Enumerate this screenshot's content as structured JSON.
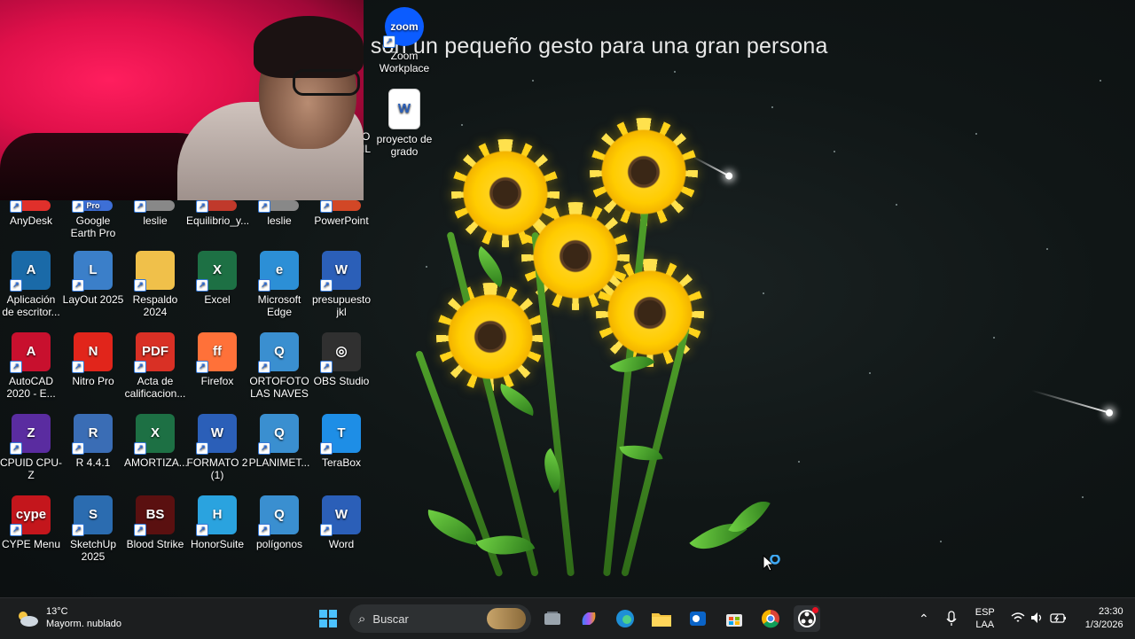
{
  "headline": "s son un pequeño gesto para una gran persona",
  "top_icons": [
    {
      "label": "Zoom Workplace",
      "badge": "zoom",
      "color": "#0b5cff"
    },
    {
      "label": "proyecto de grado",
      "badge": "W",
      "color": "#2b5fb8"
    }
  ],
  "partial_labels": [
    "O",
    "IL"
  ],
  "rows": [
    [
      {
        "label": "AnyDesk",
        "badge": "",
        "color": "#e0302b"
      },
      {
        "label": "Google Earth Pro",
        "badge": "Pro",
        "color": "#3d6fd6"
      },
      {
        "label": "leslie",
        "badge": "",
        "color": "#888"
      },
      {
        "label": "Equilibrio_y...",
        "badge": "",
        "color": "#c0392b"
      },
      {
        "label": "leslie",
        "badge": "",
        "color": "#888"
      },
      {
        "label": "PowerPoint",
        "badge": "",
        "color": "#d24726"
      }
    ],
    [
      {
        "label": "Aplicación de escritor...",
        "badge": "A",
        "color": "#1a6aa8"
      },
      {
        "label": "LayOut 2025",
        "badge": "L",
        "color": "#3b7fc9"
      },
      {
        "label": "Respaldo 2024",
        "badge": "",
        "color": "#f0c04a"
      },
      {
        "label": "Excel",
        "badge": "X",
        "color": "#1d7044"
      },
      {
        "label": "Microsoft Edge",
        "badge": "e",
        "color": "#2c8fd6"
      },
      {
        "label": "presupuesto jkl",
        "badge": "W",
        "color": "#2b5fb8"
      }
    ],
    [
      {
        "label": "AutoCAD 2020 - E...",
        "badge": "A",
        "color": "#c8102e"
      },
      {
        "label": "Nitro Pro",
        "badge": "N",
        "color": "#e1251b"
      },
      {
        "label": "Acta de calificacion...",
        "badge": "PDF",
        "color": "#d93025"
      },
      {
        "label": "Firefox",
        "badge": "ff",
        "color": "#ff7139"
      },
      {
        "label": "ORTOFOTO LAS NAVES",
        "badge": "Q",
        "color": "#3a8fd0"
      },
      {
        "label": "OBS Studio",
        "badge": "◎",
        "color": "#303030"
      }
    ],
    [
      {
        "label": "CPUID CPU-Z",
        "badge": "Z",
        "color": "#5a2ca0"
      },
      {
        "label": "R 4.4.1",
        "badge": "R",
        "color": "#3a6db5"
      },
      {
        "label": "AMORTIZA...",
        "badge": "X",
        "color": "#1d7044"
      },
      {
        "label": "FORMATO 2 (1)",
        "badge": "W",
        "color": "#2b5fb8"
      },
      {
        "label": "PLANIMET...",
        "badge": "Q",
        "color": "#3a8fd0"
      },
      {
        "label": "TeraBox",
        "badge": "T",
        "color": "#1e8ee6"
      }
    ],
    [
      {
        "label": "CYPE Menu",
        "badge": "cype",
        "color": "#c4161c"
      },
      {
        "label": "SketchUp 2025",
        "badge": "S",
        "color": "#2b6cb0"
      },
      {
        "label": "Blood Strike",
        "badge": "BS",
        "color": "#5a1010"
      },
      {
        "label": "HonorSuite",
        "badge": "H",
        "color": "#2aa3df"
      },
      {
        "label": "polígonos",
        "badge": "Q",
        "color": "#3a8fd0"
      },
      {
        "label": "Word",
        "badge": "W",
        "color": "#2b5fb8"
      }
    ]
  ],
  "taskbar": {
    "weather_temp": "13°C",
    "weather_desc": "Mayorm. nublado",
    "search_placeholder": "Buscar",
    "lang_top": "ESP",
    "lang_bottom": "LAA",
    "time": "23:30",
    "date": "1/3/2026"
  }
}
